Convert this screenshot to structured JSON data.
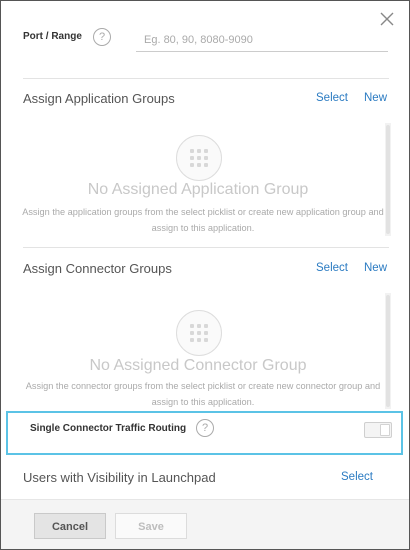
{
  "port": {
    "label": "Port / Range",
    "help_glyph": "?",
    "placeholder": "Eg. 80, 90, 8080-9090",
    "value": ""
  },
  "app_groups": {
    "title": "Assign Application Groups",
    "select_label": "Select",
    "new_label": "New",
    "empty_title": "No Assigned Application Group",
    "empty_desc": "Assign the application groups from the select picklist or create new application group and assign to this application."
  },
  "connector_groups": {
    "title": "Assign Connector Groups",
    "select_label": "Select",
    "new_label": "New",
    "empty_title": "No Assigned Connector Group",
    "empty_desc": "Assign the connector groups from the select picklist or create new connector group and assign to this application."
  },
  "routing": {
    "label": "Single Connector Traffic Routing",
    "help_glyph": "?",
    "enabled": false
  },
  "launchpad": {
    "title": "Users with Visibility in Launchpad",
    "select_label": "Select"
  },
  "footer": {
    "cancel_label": "Cancel",
    "save_label": "Save"
  },
  "colors": {
    "link": "#2b7bc2",
    "highlight_border": "#5bc3e6"
  },
  "icons": {
    "close": "close-icon",
    "help": "help-circle-icon",
    "empty_state": "apps-grid-icon"
  }
}
